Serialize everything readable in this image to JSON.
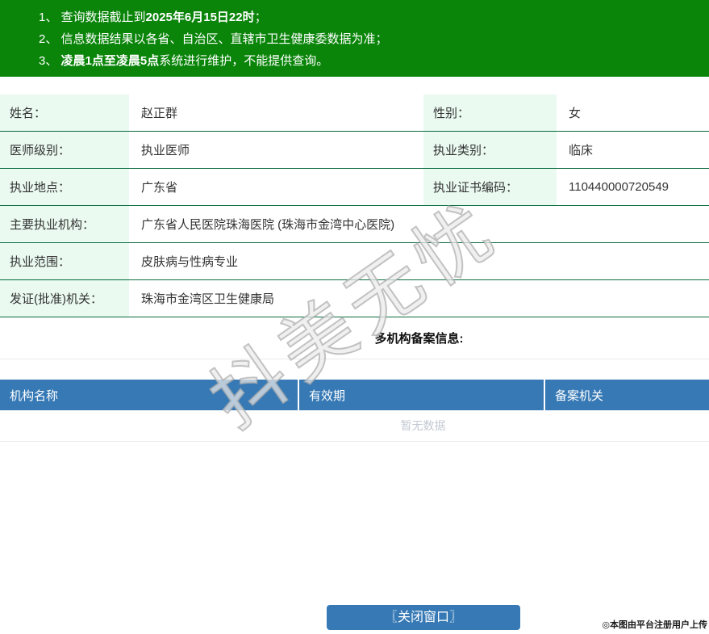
{
  "colors": {
    "banner-green": "#0a850a",
    "border-green": "#0b6b3e",
    "label-bg": "#eafaf1",
    "header-blue": "#3679b5"
  },
  "notices": [
    {
      "prefix": "1、 查询数据截止到",
      "bold": "2025年6月15日22时",
      "suffix": "；"
    },
    {
      "prefix": "2、 信息数据结果以各省、自治区、直辖市卫生健康委数据为准；",
      "bold": "",
      "suffix": ""
    },
    {
      "prefix": "3、 ",
      "bold": "凌晨1点至凌晨5点",
      "suffix": "系统进行维护，不能提供查询。"
    }
  ],
  "doctor": {
    "name_label": "姓名：",
    "name": "赵正群",
    "gender_label": "性别：",
    "gender": "女",
    "level_label": "医师级别：",
    "level": "执业医师",
    "category_label": "执业类别：",
    "category": "临床",
    "location_label": "执业地点：",
    "location": "广东省",
    "cert_no_label": "执业证书编码：",
    "cert_no": "110440000720549",
    "main_org_label": "主要执业机构：",
    "main_org": "广东省人民医院珠海医院 (珠海市金湾中心医院)",
    "scope_label": "执业范围：",
    "scope": "皮肤病与性病专业",
    "issuer_label": "发证(批准)机关：",
    "issuer": "珠海市金湾区卫生健康局"
  },
  "multi_org": {
    "heading": "多机构备案信息:",
    "columns": [
      "机构名称",
      "有效期",
      "备案机关"
    ],
    "empty_text": "暂无数据"
  },
  "watermark": "抖美无忧",
  "footer": {
    "close_button": "〖关闭窗口〗",
    "credit": "◎本图由平台注册用户上传"
  }
}
